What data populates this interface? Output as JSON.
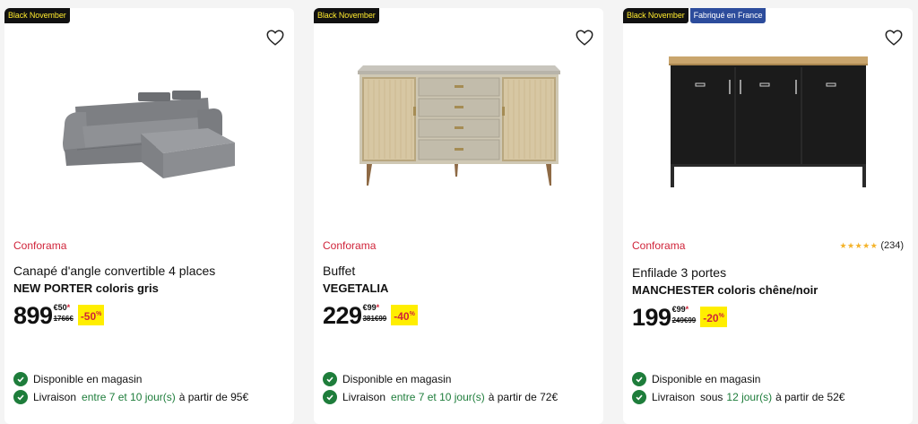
{
  "colors": {
    "brand_red": "#d0243a",
    "badge_yellow": "#ffea2e",
    "badge_blue": "#2c4c9c",
    "available_green": "#1e7d3b",
    "discount_bg": "#ffee00"
  },
  "products": [
    {
      "badges": [
        "Black November"
      ],
      "brand": "Conforama",
      "title": "Canapé d'angle convertible 4 places",
      "subtitle": "NEW PORTER coloris gris",
      "price_main": "899",
      "price_cents": "€50",
      "price_star": "*",
      "old_price": "1766€",
      "discount": "-50",
      "discount_suffix": "%",
      "availability": "Disponible en magasin",
      "delivery_label": "Livraison",
      "delivery_range": "entre 7 et 10 jour(s)",
      "delivery_price": "à partir de 95€",
      "image_icon": "sofa-image"
    },
    {
      "badges": [
        "Black November"
      ],
      "brand": "Conforama",
      "title": "Buffet",
      "subtitle": "VEGETALIA",
      "price_main": "229",
      "price_cents": "€99",
      "price_star": "*",
      "old_price": "381€99",
      "discount": "-40",
      "discount_suffix": "%",
      "availability": "Disponible en magasin",
      "delivery_label": "Livraison",
      "delivery_range": "entre 7 et 10 jour(s)",
      "delivery_price": "à partir de 72€",
      "image_icon": "sideboard-image"
    },
    {
      "badges": [
        "Black November",
        "Fabriqué en France"
      ],
      "brand": "Conforama",
      "rating_stars": "★★★★★",
      "rating_value": 4.5,
      "rating_count": "(234)",
      "title": "Enfilade 3 portes",
      "subtitle": "MANCHESTER coloris chêne/noir",
      "price_main": "199",
      "price_cents": "€99",
      "price_star": "*",
      "old_price": "249€99",
      "discount": "-20",
      "discount_suffix": "%",
      "availability": "Disponible en magasin",
      "delivery_label": "Livraison",
      "delivery_prefix": "sous",
      "delivery_range": "12 jour(s)",
      "delivery_price": "à partir de 52€",
      "image_icon": "enfilade-image"
    }
  ]
}
